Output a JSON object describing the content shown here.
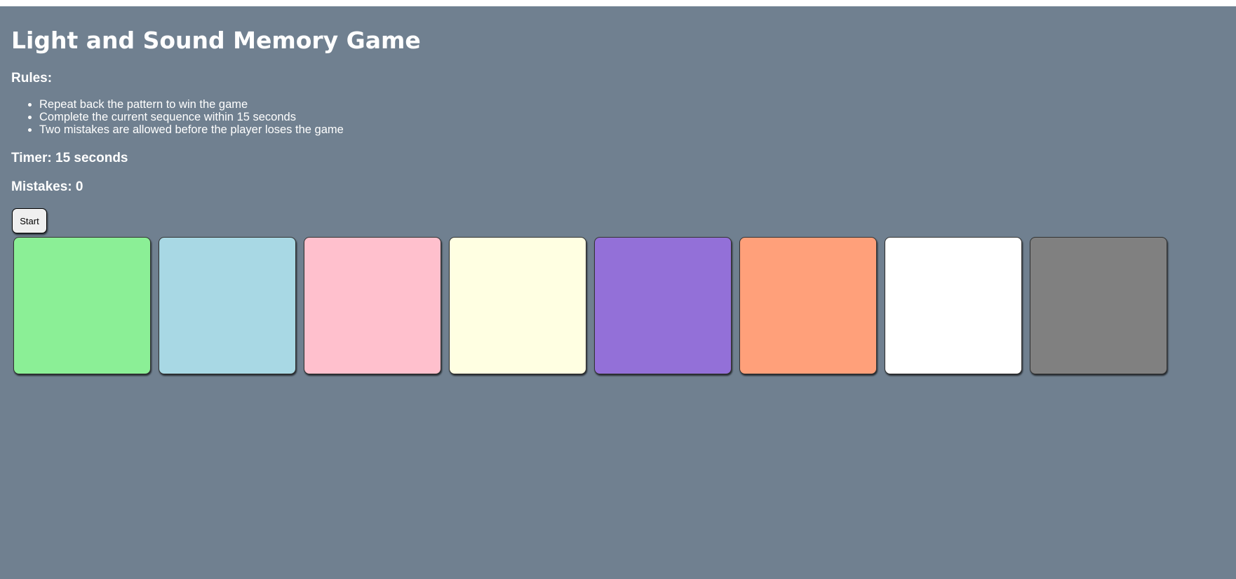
{
  "title": "Light and Sound Memory Game",
  "rules": {
    "heading": "Rules:",
    "items": [
      "Repeat back the pattern to win the game",
      "Complete the current sequence within 15 seconds",
      "Two mistakes are allowed before the player loses the game"
    ]
  },
  "timer_text": "Timer: 15 seconds",
  "mistakes_text": "Mistakes: 0",
  "start_label": "Start",
  "colors": {
    "background": "#708090",
    "pads": [
      "#8bef96",
      "#a8d8e4",
      "#ffc0cd",
      "#ffffe2",
      "#9370d8",
      "#ffa07a",
      "#ffffff",
      "#808080"
    ]
  }
}
